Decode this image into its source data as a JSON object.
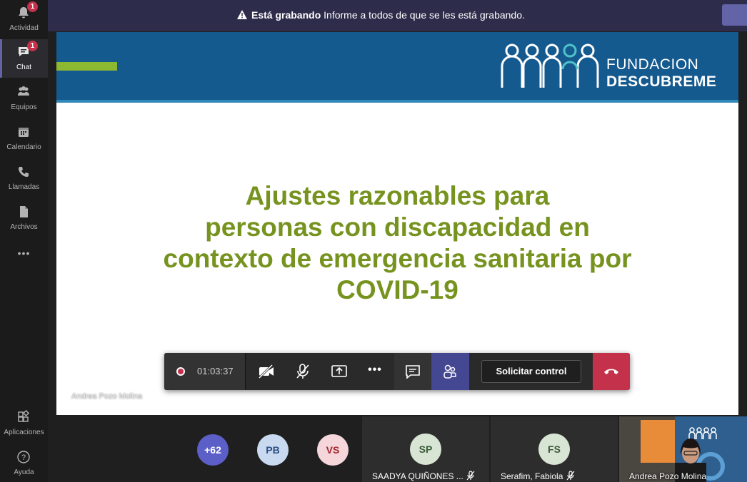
{
  "rail": {
    "items": [
      {
        "label": "Actividad",
        "badge": "1",
        "icon": "bell-icon"
      },
      {
        "label": "Chat",
        "badge": "1",
        "icon": "chat-icon"
      },
      {
        "label": "Equipos",
        "icon": "teams-icon"
      },
      {
        "label": "Calendario",
        "icon": "calendar-icon"
      },
      {
        "label": "Llamadas",
        "icon": "phone-icon"
      },
      {
        "label": "Archivos",
        "icon": "file-icon"
      },
      {
        "label": "Aplicaciones",
        "icon": "apps-icon"
      },
      {
        "label": "Ayuda",
        "icon": "help-icon"
      }
    ],
    "more": "•••"
  },
  "banner": {
    "bold": "Está grabando",
    "text": "Informe a todos de que se les está grabando."
  },
  "slide": {
    "logo_top": "FUNDACION",
    "logo_bottom": "DESCUBREME",
    "title_lines": [
      "Ajustes razonables para",
      "personas con discapacidad en",
      "contexto de emergencia sanitaria por",
      "COVID-19"
    ],
    "presenter": "Andrea Pozo Molina"
  },
  "controls": {
    "time": "01:03:37",
    "solicitar": "Solicitar control",
    "more": "•••"
  },
  "participants": {
    "overflow": "+62",
    "avatars": [
      {
        "initials": "PB"
      },
      {
        "initials": "VS"
      }
    ],
    "tiles": [
      {
        "initials": "SP",
        "name": "SAADYA QUIÑONES ..."
      },
      {
        "initials": "FS",
        "name": "Serafim, Fabiola"
      }
    ],
    "video_name": "Andrea Pozo Molina"
  },
  "colors": {
    "accent": "#6264a7",
    "slide_title": "#77931f",
    "slide_header": "#155a8f",
    "hangup": "#c4314b"
  }
}
